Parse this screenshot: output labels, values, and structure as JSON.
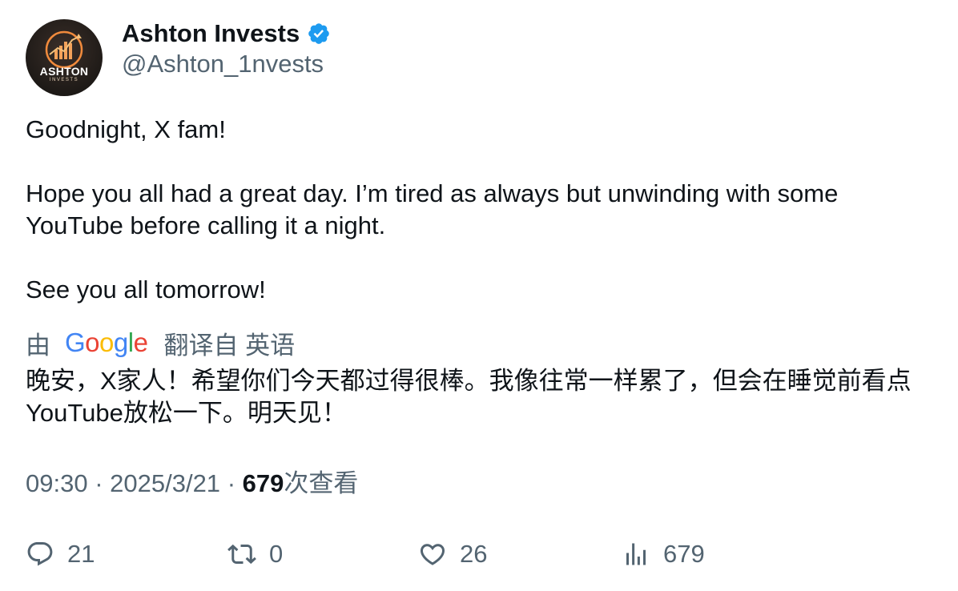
{
  "author": {
    "display_name": "Ashton Invests",
    "handle": "@Ashton_1nvests",
    "avatar_text": "ASHTON",
    "avatar_subtext": "INVESTS",
    "verified_icon": "verified-badge-icon",
    "verified_color": "#1d9bf0"
  },
  "tweet": {
    "paragraphs": [
      "Goodnight, X fam!",
      "Hope you all had a great day. I’m tired as always but unwinding with some YouTube before calling it a night.",
      "See you all tomorrow!"
    ]
  },
  "translation": {
    "prefix": "由",
    "provider": "Google",
    "suffix": "翻译自 英语",
    "text": "晚安，X家人！希望你们今天都过得很棒。我像往常一样累了，但会在睡觉前看点YouTube放松一下。明天见！"
  },
  "meta": {
    "time": "09:30",
    "separator": "·",
    "date": "2025/3/21",
    "views_count": "679",
    "views_label": "次查看"
  },
  "actions": {
    "replies": "21",
    "reposts": "0",
    "likes": "26",
    "views": "679"
  },
  "colors": {
    "text_primary": "#0f1419",
    "text_secondary": "#536471",
    "google_blue": "#4285F4",
    "google_red": "#EA4335",
    "google_yellow": "#FBBC05",
    "google_green": "#34A853"
  }
}
